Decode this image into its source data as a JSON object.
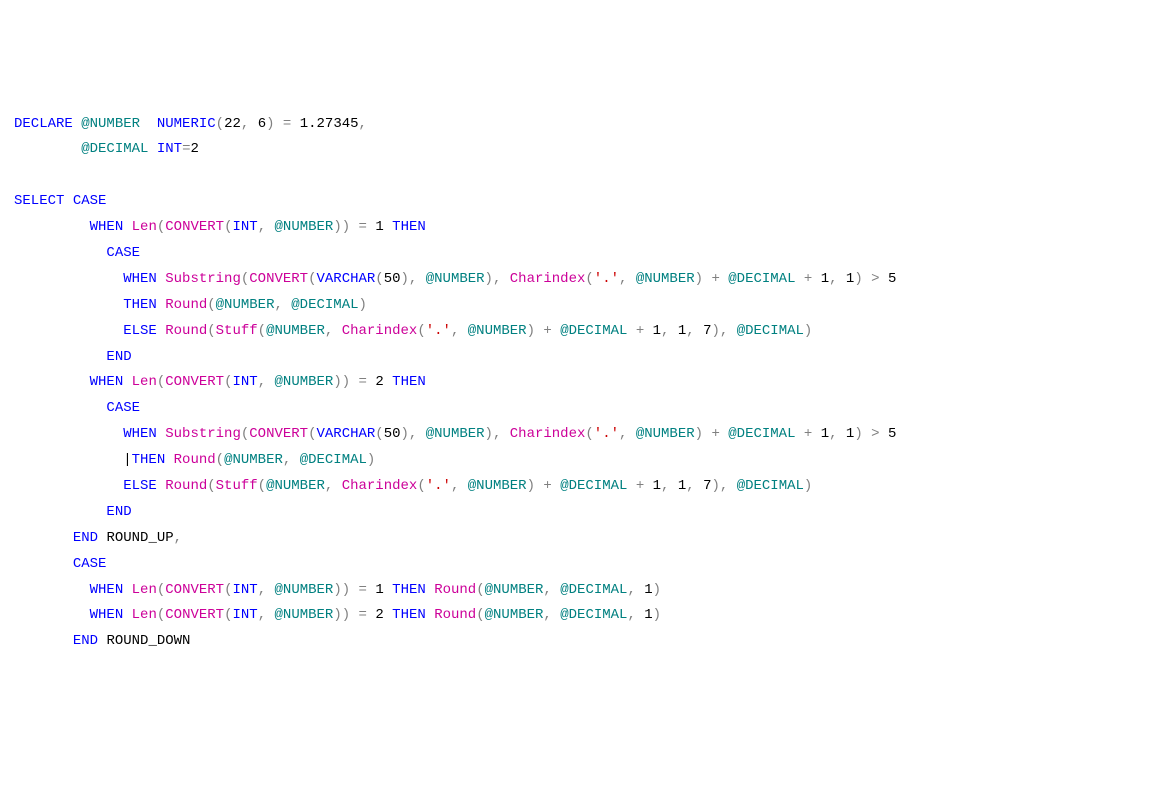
{
  "code": {
    "line1": {
      "declare": "DECLARE",
      "var1": "@NUMBER",
      "type1": "NUMERIC",
      "tparen_o": "(",
      "tn1": "22",
      "tc": ",",
      "sp": " ",
      "tn2": "6",
      "tparen_c": ")",
      "eq": " = ",
      "val1": "1.27345",
      "comma": ","
    },
    "line2": {
      "var": "@DECIMAL",
      "type": "INT",
      "eq": "=",
      "val": "2"
    },
    "line4": {
      "select": "SELECT",
      "case": "CASE"
    },
    "line5": {
      "when": "WHEN",
      "len": "Len",
      "po": "(",
      "convert": "CONVERT",
      "po2": "(",
      "int": "INT",
      "c": ",",
      "sp": " ",
      "var": "@NUMBER",
      "pc2": ")",
      "pc": ")",
      "eq": " = ",
      "n": "1",
      "sp2": " ",
      "then": "THEN"
    },
    "line6": {
      "case": "CASE"
    },
    "line7": {
      "when": "WHEN",
      "sub": "Substring",
      "po": "(",
      "convert": "CONVERT",
      "po2": "(",
      "vc": "VARCHAR",
      "po3": "(",
      "n50": "50",
      "pc3": ")",
      "c": ",",
      "sp": " ",
      "var": "@NUMBER",
      "pc2": ")",
      "c2": ",",
      "sp2": " ",
      "ci": "Charindex",
      "po4": "(",
      "str": "'.'",
      "c3": ",",
      "sp3": " ",
      "var2": "@NUMBER",
      "pc4": ")",
      "plus": " + ",
      "var3": "@DECIMAL",
      "plus2": " + ",
      "n1": "1",
      "c4": ",",
      "sp4": " ",
      "n1b": "1",
      "pc": ")",
      "gt": " > ",
      "n5": "5"
    },
    "line8": {
      "then": "THEN",
      "round": "Round",
      "po": "(",
      "var": "@NUMBER",
      "c": ",",
      "sp": " ",
      "var2": "@DECIMAL",
      "pc": ")"
    },
    "line9": {
      "else": "ELSE",
      "round": "Round",
      "po": "(",
      "stuff": "Stuff",
      "po2": "(",
      "var": "@NUMBER",
      "c": ",",
      "sp": " ",
      "ci": "Charindex",
      "po3": "(",
      "str": "'.'",
      "c2": ",",
      "sp2": " ",
      "var2": "@NUMBER",
      "pc3": ")",
      "plus": " + ",
      "var3": "@DECIMAL",
      "plus2": " + ",
      "n1": "1",
      "c3": ",",
      "sp3": " ",
      "n1b": "1",
      "c4": ",",
      "sp4": " ",
      "n7": "7",
      "pc2": ")",
      "c5": ",",
      "sp5": " ",
      "var4": "@DECIMAL",
      "pc": ")"
    },
    "line10": {
      "end": "END"
    },
    "line11": {
      "when": "WHEN",
      "len": "Len",
      "po": "(",
      "convert": "CONVERT",
      "po2": "(",
      "int": "INT",
      "c": ",",
      "sp": " ",
      "var": "@NUMBER",
      "pc2": ")",
      "pc": ")",
      "eq": " = ",
      "n": "2",
      "sp2": " ",
      "then": "THEN"
    },
    "line12": {
      "case": "CASE"
    },
    "line13": {
      "when": "WHEN",
      "sub": "Substring",
      "po": "(",
      "convert": "CONVERT",
      "po2": "(",
      "vc": "VARCHAR",
      "po3": "(",
      "n50": "50",
      "pc3": ")",
      "c": ",",
      "sp": " ",
      "var": "@NUMBER",
      "pc2": ")",
      "c2": ",",
      "sp2": " ",
      "ci": "Charindex",
      "po4": "(",
      "str": "'.'",
      "c3": ",",
      "sp3": " ",
      "var2": "@NUMBER",
      "pc4": ")",
      "plus": " + ",
      "var3": "@DECIMAL",
      "plus2": " + ",
      "n1": "1",
      "c4": ",",
      "sp4": " ",
      "n1b": "1",
      "pc": ")",
      "gt": " > ",
      "n5": "5"
    },
    "line14cursor": "|",
    "line14": {
      "then": "THEN",
      "round": "Round",
      "po": "(",
      "var": "@NUMBER",
      "c": ",",
      "sp": " ",
      "var2": "@DECIMAL",
      "pc": ")"
    },
    "line15": {
      "else": "ELSE",
      "round": "Round",
      "po": "(",
      "stuff": "Stuff",
      "po2": "(",
      "var": "@NUMBER",
      "c": ",",
      "sp": " ",
      "ci": "Charindex",
      "po3": "(",
      "str": "'.'",
      "c2": ",",
      "sp2": " ",
      "var2": "@NUMBER",
      "pc3": ")",
      "plus": " + ",
      "var3": "@DECIMAL",
      "plus2": " + ",
      "n1": "1",
      "c3": ",",
      "sp3": " ",
      "n1b": "1",
      "c4": ",",
      "sp4": " ",
      "n7": "7",
      "pc2": ")",
      "c5": ",",
      "sp5": " ",
      "var4": "@DECIMAL",
      "pc": ")"
    },
    "line16": {
      "end": "END"
    },
    "line17": {
      "end": "END",
      "id": "ROUND_UP",
      "c": ","
    },
    "line18": {
      "case": "CASE"
    },
    "line19": {
      "when": "WHEN",
      "len": "Len",
      "po": "(",
      "convert": "CONVERT",
      "po2": "(",
      "int": "INT",
      "c": ",",
      "sp": " ",
      "var": "@NUMBER",
      "pc2": ")",
      "pc": ")",
      "eq": " = ",
      "n": "1",
      "sp2": " ",
      "then": "THEN",
      "sp3": " ",
      "round": "Round",
      "po3": "(",
      "var2": "@NUMBER",
      "c2": ",",
      "sp4": " ",
      "var3": "@DECIMAL",
      "c3": ",",
      "sp5": " ",
      "n1": "1",
      "pc3": ")"
    },
    "line20": {
      "when": "WHEN",
      "len": "Len",
      "po": "(",
      "convert": "CONVERT",
      "po2": "(",
      "int": "INT",
      "c": ",",
      "sp": " ",
      "var": "@NUMBER",
      "pc2": ")",
      "pc": ")",
      "eq": " = ",
      "n": "2",
      "sp2": " ",
      "then": "THEN",
      "sp3": " ",
      "round": "Round",
      "po3": "(",
      "var2": "@NUMBER",
      "c2": ",",
      "sp4": " ",
      "var3": "@DECIMAL",
      "c3": ",",
      "sp5": " ",
      "n1": "1",
      "pc3": ")"
    },
    "line21": {
      "end": "END",
      "id": "ROUND_DOWN"
    }
  }
}
